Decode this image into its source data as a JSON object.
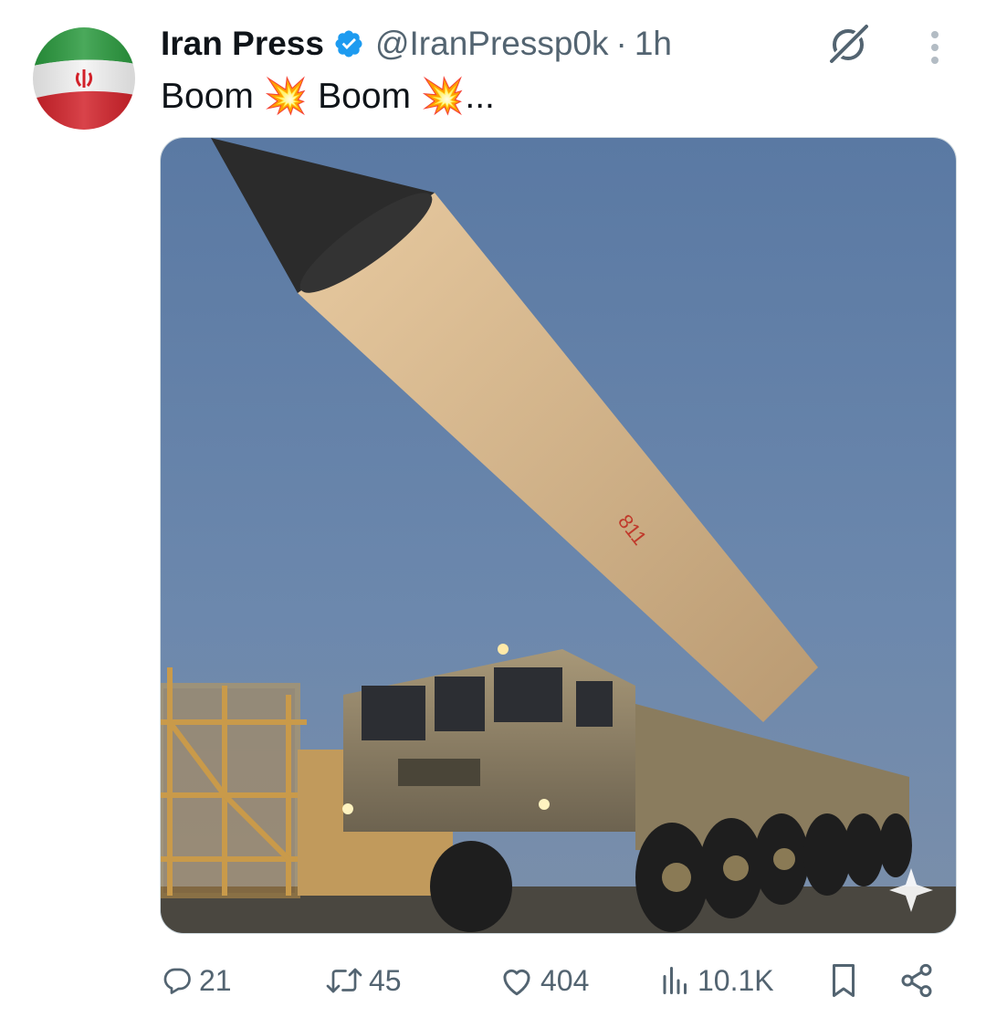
{
  "tweet": {
    "display_name": "Iran Press",
    "handle": "@IranPressp0k",
    "separator": "·",
    "time": "1h",
    "text": "Boom 💥 Boom 💥...",
    "verified_color": "#1d9bf0"
  },
  "media": {
    "alt": "Missile on launcher truck",
    "sky_color": "#5f7ea8",
    "missile_marking": "811"
  },
  "actions": {
    "replies": "21",
    "reposts": "45",
    "likes": "404",
    "views": "10.1K"
  },
  "icons": {
    "avatar": "iran-flag-icon",
    "verified": "verified-badge-icon",
    "grok": "grok-icon",
    "more": "more-dots-icon",
    "reply": "reply-icon",
    "repost": "repost-icon",
    "like": "heart-icon",
    "views": "views-chart-icon",
    "bookmark": "bookmark-icon",
    "share": "share-icon"
  }
}
